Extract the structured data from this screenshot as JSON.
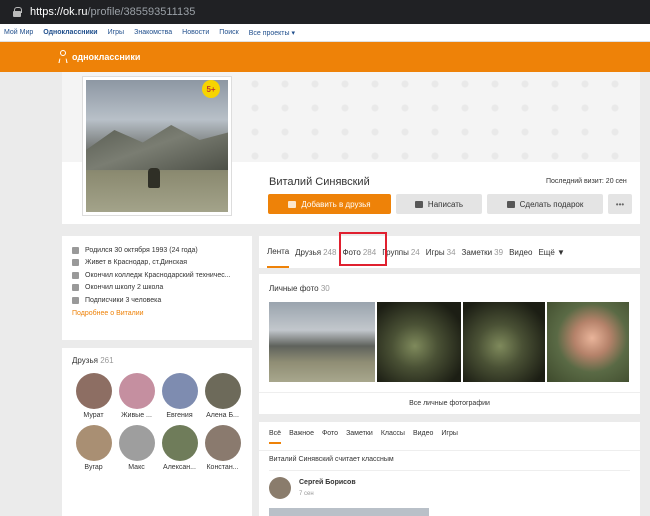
{
  "browser": {
    "url_host": "https://ok.ru",
    "url_path": "/profile/385593511135"
  },
  "topnav": [
    "Мой Мир",
    "Одноклассники",
    "Игры",
    "Знакомства",
    "Новости",
    "Поиск",
    "Все проекты ▾"
  ],
  "header": {
    "brand": "одноклассники"
  },
  "profile": {
    "name": "Виталий Синявский",
    "last_visit": "Последний визит: 20 сен",
    "badge": "5+",
    "buttons": {
      "add_friend": "Добавить в друзья",
      "write": "Написать",
      "gift": "Сделать подарок",
      "more": "•••"
    }
  },
  "info": {
    "rows": [
      "Родился 30 октября 1993 (24 года)",
      "Живет в Краснодар, ст.Динская",
      "Окончил колледж Краснодарский техничес...",
      "Окончил школу 2 школа",
      "Подписчики 3 человека"
    ],
    "more_link": "Подробнее о Виталии"
  },
  "friends": {
    "title": "Друзья",
    "count": "261",
    "list": [
      "Мурат",
      "Живые ...",
      "Евгения",
      "Алена Б...",
      "Вугар",
      "Макс",
      "Алексан...",
      "Констан..."
    ],
    "avatar_colors": [
      "#8d6e63",
      "#c58fa0",
      "#7e8cb0",
      "#6d6a5a",
      "#a98f73",
      "#9e9e9e",
      "#6f7c5a",
      "#8a7a6e"
    ]
  },
  "tabs": [
    {
      "label": "Лента",
      "count": ""
    },
    {
      "label": "Друзья",
      "count": "248"
    },
    {
      "label": "Фото",
      "count": "284"
    },
    {
      "label": "Группы",
      "count": "24"
    },
    {
      "label": "Игры",
      "count": "34"
    },
    {
      "label": "Заметки",
      "count": "39"
    },
    {
      "label": "Видео",
      "count": ""
    },
    {
      "label": "Ещё ▼",
      "count": ""
    }
  ],
  "photos": {
    "title": "Личные фото",
    "count": "30",
    "footer": "Все личные фотографии"
  },
  "feed": {
    "tabs": [
      "Всё",
      "Важное",
      "Фото",
      "Заметки",
      "Классы",
      "Видео",
      "Игры"
    ],
    "like_text": "Виталий Синявский считает классным",
    "author": "Сергей Борисов",
    "time": "7 сен"
  },
  "colors": {
    "brand": "#ee8208",
    "highlight": "#e0202f",
    "badge": "#f7d400"
  }
}
